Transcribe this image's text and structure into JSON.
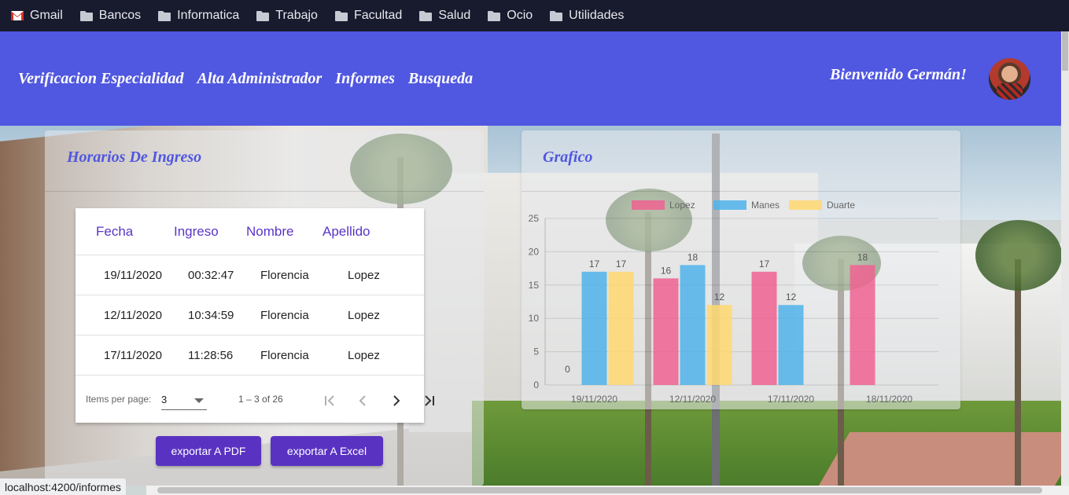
{
  "bookmarks": [
    {
      "label": "Gmail",
      "icon": "gmail-icon"
    },
    {
      "label": "Bancos",
      "icon": "folder-icon"
    },
    {
      "label": "Informatica",
      "icon": "folder-icon"
    },
    {
      "label": "Trabajo",
      "icon": "folder-icon"
    },
    {
      "label": "Facultad",
      "icon": "folder-icon"
    },
    {
      "label": "Salud",
      "icon": "folder-icon"
    },
    {
      "label": "Ocio",
      "icon": "folder-icon"
    },
    {
      "label": "Utilidades",
      "icon": "folder-icon"
    }
  ],
  "colors": {
    "header": "#5057e0",
    "accent": "#5a32c2",
    "series_lopez": "#f06292",
    "series_manes": "#4fb3ea",
    "series_duarte": "#ffd870"
  },
  "header": {
    "nav": [
      "Verificacion Especialidad",
      "Alta Administrador",
      "Informes",
      "Busqueda"
    ],
    "welcome": "Bienvenido Germán!",
    "avatar_icon": "user-avatar"
  },
  "ingresos": {
    "title": "Horarios De Ingreso",
    "columns": [
      "Fecha",
      "Ingreso",
      "Nombre",
      "Apellido"
    ],
    "rows": [
      [
        "19/11/2020",
        "00:32:47",
        "Florencia",
        "Lopez"
      ],
      [
        "12/11/2020",
        "10:34:59",
        "Florencia",
        "Lopez"
      ],
      [
        "17/11/2020",
        "11:28:56",
        "Florencia",
        "Lopez"
      ]
    ],
    "paginator": {
      "items_per_page_label": "Items per page:",
      "items_per_page": "3",
      "range": "1 – 3 of 26"
    },
    "export_pdf": "exportar A PDF",
    "export_excel": "exportar A Excel"
  },
  "grafico": {
    "title": "Grafico"
  },
  "chart_data": {
    "type": "bar",
    "categories": [
      "19/11/2020",
      "12/11/2020",
      "17/11/2020",
      "18/11/2020"
    ],
    "series": [
      {
        "name": "Lopez",
        "values": [
          0,
          16,
          17,
          18
        ]
      },
      {
        "name": "Manes",
        "values": [
          17,
          18,
          12,
          0
        ]
      },
      {
        "name": "Duarte",
        "values": [
          17,
          12,
          0,
          0
        ]
      }
    ],
    "ylim": [
      0,
      25
    ],
    "yticks": [
      0,
      5,
      10,
      15,
      20,
      25
    ],
    "data_labels": [
      [
        "0",
        "16",
        "17",
        "18"
      ],
      [
        "17",
        "18",
        "12",
        ""
      ],
      [
        "17",
        "12",
        "",
        ""
      ]
    ],
    "legend": "top",
    "grid": true
  },
  "status_url": "localhost:4200/informes"
}
